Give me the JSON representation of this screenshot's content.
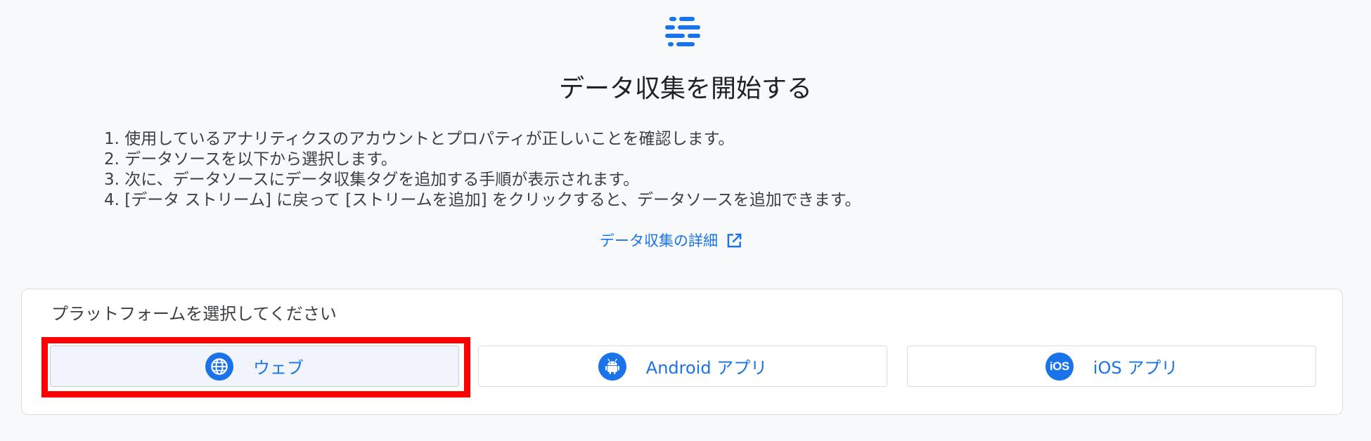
{
  "header": {
    "logo_icon": "data-streams-icon",
    "title": "データ収集を開始する"
  },
  "steps": [
    "1. 使用しているアナリティクスのアカウントとプロパティが正しいことを確認します。",
    "2. データソースを以下から選択します。",
    "3. 次に、データソースにデータ収集タグを追加する手順が表示されます。",
    "4. [データ ストリーム] に戻って [ストリームを追加] をクリックすると、データソースを追加できます。"
  ],
  "learn_more": {
    "label": "データ収集の詳細",
    "icon": "open-in-new-icon"
  },
  "platform_card": {
    "title": "プラットフォームを選択してください",
    "options": [
      {
        "label": "ウェブ",
        "icon": "globe-icon",
        "selected": true
      },
      {
        "label": "Android アプリ",
        "icon": "android-icon",
        "selected": false
      },
      {
        "label": "iOS アプリ",
        "icon": "ios-icon",
        "icon_text": "iOS",
        "selected": false
      }
    ]
  },
  "colors": {
    "accent": "#1a73e8",
    "highlight": "#ff0000",
    "background": "#f8f9fa"
  }
}
